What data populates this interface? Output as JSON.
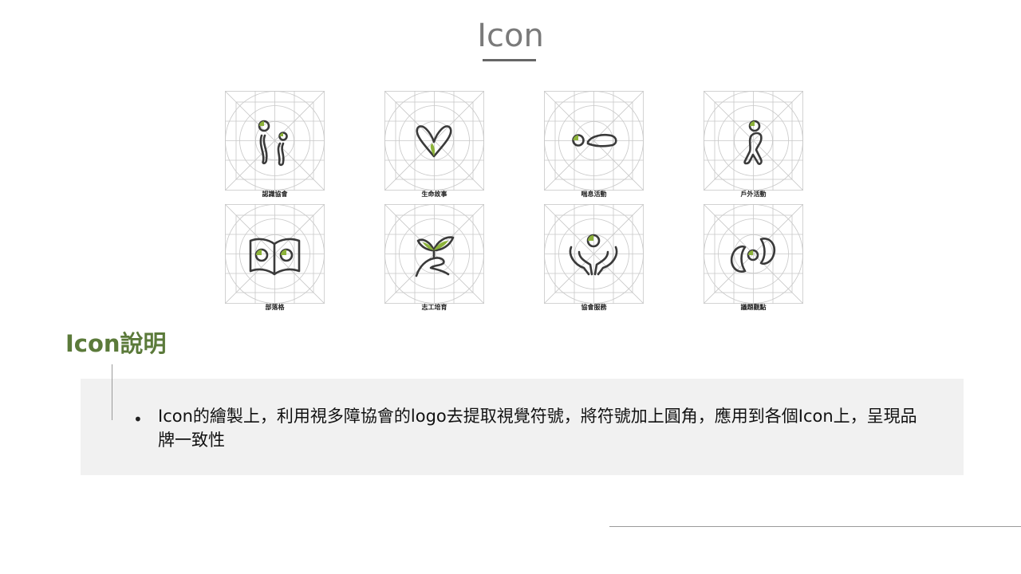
{
  "slide": {
    "title": "Icon",
    "section_title": "Icon說明",
    "description": "Icon的繪製上，利用視多障協會的logo去提取視覺符號，將符號加上圓角，應用到各個Icon上，呈現品牌一致性"
  },
  "icons": [
    {
      "label": "認識協會",
      "icon": "two-figures-icon"
    },
    {
      "label": "生命故事",
      "icon": "heart-sprout-icon"
    },
    {
      "label": "喘息活動",
      "icon": "resting-figure-icon"
    },
    {
      "label": "戶外活動",
      "icon": "walking-figure-icon"
    },
    {
      "label": "部落格",
      "icon": "open-book-icon"
    },
    {
      "label": "志工培育",
      "icon": "hand-sprout-icon"
    },
    {
      "label": "協會服務",
      "icon": "supporting-hands-icon"
    },
    {
      "label": "議題觀點",
      "icon": "swirl-figure-icon"
    }
  ],
  "colors": {
    "accent_green": "#8db33a",
    "section_green": "#5b7a3a",
    "grid_gray": "#c8c8c8",
    "stroke_dark": "#3a3a3a"
  }
}
